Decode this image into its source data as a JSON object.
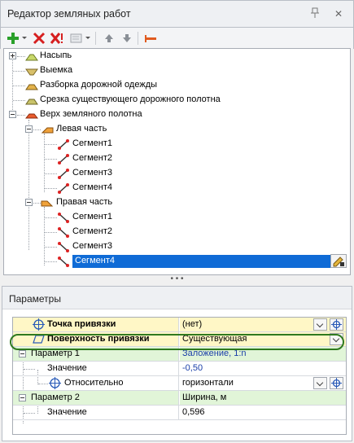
{
  "window": {
    "title": "Редактор земляных работ"
  },
  "toolbar": {
    "buttons": [
      "add",
      "delete",
      "delete-all",
      "properties",
      "move-up",
      "move-down",
      "edit-segment"
    ],
    "colors": {
      "add": "#2aa02a",
      "delete": "#d61f1f",
      "arrow": "#7a7f87",
      "accent": "#e05a1f"
    }
  },
  "tree": {
    "items": [
      {
        "label": "Насыпь",
        "icon": "embankment-icon"
      },
      {
        "label": "Выемка",
        "icon": "excavation-icon"
      },
      {
        "label": "Разборка дорожной одежды",
        "icon": "pavement-removal-icon"
      },
      {
        "label": "Срезка существующего дорожного полотна",
        "icon": "road-cut-icon"
      },
      {
        "label": "Верх земляного полотна",
        "icon": "subgrade-top-icon",
        "children": [
          {
            "label": "Левая часть",
            "icon": "left-side-icon",
            "children": [
              "Сегмент1",
              "Сегмент2",
              "Сегмент3",
              "Сегмент4"
            ]
          },
          {
            "label": "Правая часть",
            "icon": "right-side-icon",
            "children": [
              "Сегмент1",
              "Сегмент2",
              "Сегмент3",
              "Сегмент4"
            ]
          }
        ]
      }
    ],
    "selected": "Правая часть / Сегмент4"
  },
  "params": {
    "title": "Параметры",
    "rows": [
      {
        "name": "Точка привязки",
        "value": "(нет)"
      },
      {
        "name": "Поверхность привязки",
        "value": "Существующая"
      },
      {
        "name": "Параметр 1",
        "value": "Заложение, 1:n"
      },
      {
        "name": "Значение",
        "value": "-0,50"
      },
      {
        "name": "Относительно",
        "value": "горизонтали"
      },
      {
        "name": "Параметр 2",
        "value": "Ширина, м"
      },
      {
        "name": "Значение",
        "value": "0,596"
      }
    ],
    "colors": {
      "highlight": "#2f7a1f",
      "yellow_row": "#fff7c6",
      "green_row": "#e1f5d8",
      "blue_value": "#1a3fa8"
    }
  }
}
